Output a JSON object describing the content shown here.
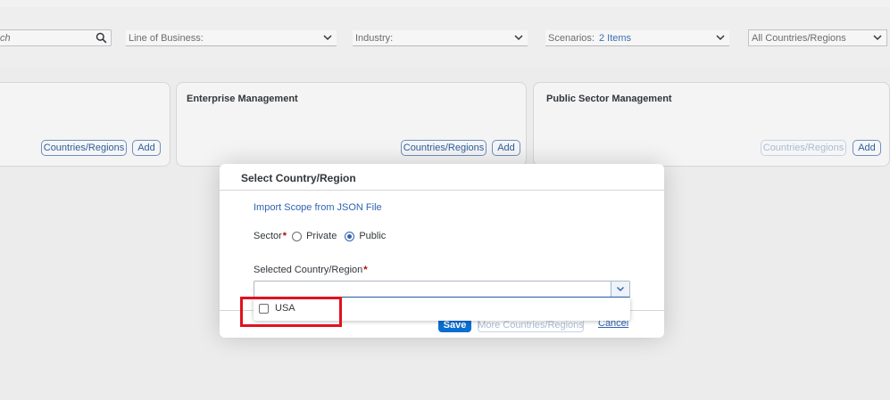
{
  "filters": {
    "search": {
      "placeholder": "ch"
    },
    "line_of_business": {
      "label": "Line of Business:",
      "value": ""
    },
    "industry": {
      "label": "Industry:",
      "value": ""
    },
    "scenarios": {
      "label": "Scenarios:",
      "value": "2 Items"
    },
    "countries": {
      "label": "All Countries/Regions"
    }
  },
  "cards": [
    {
      "title": "",
      "countries_label": "Countries/Regions",
      "add_label": "Add",
      "countries_enabled": true
    },
    {
      "title": "Enterprise Management",
      "countries_label": "Countries/Regions",
      "add_label": "Add",
      "countries_enabled": true
    },
    {
      "title": "Public Sector Management",
      "countries_label": "Countries/Regions",
      "add_label": "Add",
      "countries_enabled": false
    }
  ],
  "dialog": {
    "title": "Select Country/Region",
    "import_link": "Import Scope from JSON File",
    "sector": {
      "label": "Sector",
      "required_mark": "*",
      "options": [
        {
          "label": "Private",
          "selected": false
        },
        {
          "label": "Public",
          "selected": true
        }
      ]
    },
    "selected_country": {
      "label": "Selected Country/Region",
      "required_mark": "*",
      "value": "",
      "options": [
        {
          "label": "USA",
          "checked": false
        }
      ]
    },
    "buttons": {
      "save": "Save",
      "more": "More Countries/Regions",
      "cancel": "Cancel"
    }
  },
  "colors": {
    "accent": "#0a6ed1",
    "link": "#2f63b2",
    "required": "#bb0000",
    "highlight_box": "#e0121f"
  }
}
